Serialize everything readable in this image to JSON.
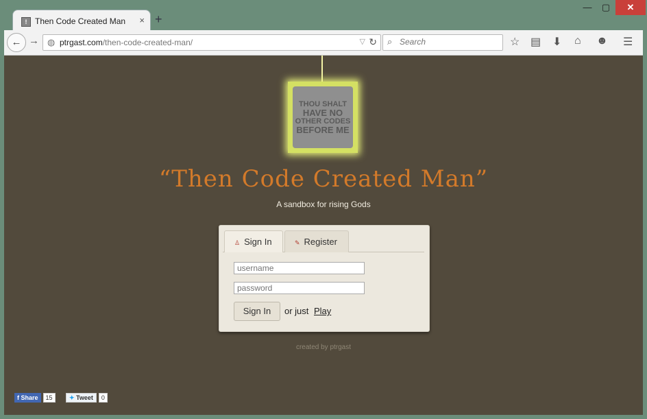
{
  "browser": {
    "tab_title": "Then Code Created Man",
    "tab_close": "×",
    "new_tab": "+",
    "window_controls": {
      "minimize": "—",
      "maximize": "▢",
      "close": "✕"
    },
    "url_domain": "ptrgast.com",
    "url_path": "/then-code-created-man/",
    "search_placeholder": "Search",
    "toolbar_icons": [
      "star-icon",
      "reading-list-icon",
      "download-icon",
      "home-icon",
      "chat-icon",
      "menu-icon"
    ]
  },
  "page": {
    "stone_lines": [
      "THOU SHALT",
      "HAVE NO",
      "OTHER CODES",
      "BEFORE ME"
    ],
    "title": "“Then Code Created Man”",
    "subtitle": "A sandbox for rising Gods",
    "tabs": [
      {
        "label": "Sign In",
        "active": true
      },
      {
        "label": "Register",
        "active": false
      }
    ],
    "username_placeholder": "username",
    "password_placeholder": "password",
    "signin_button": "Sign In",
    "or_just": "or just",
    "play_link": "Play",
    "credit": "created by ptrgast",
    "social": {
      "fb_label": "Share",
      "fb_count": "15",
      "tw_label": "Tweet",
      "tw_count": "0"
    },
    "colors": {
      "background": "#524a3c",
      "title": "#d37a2a",
      "glow": "#e9f27a"
    }
  }
}
